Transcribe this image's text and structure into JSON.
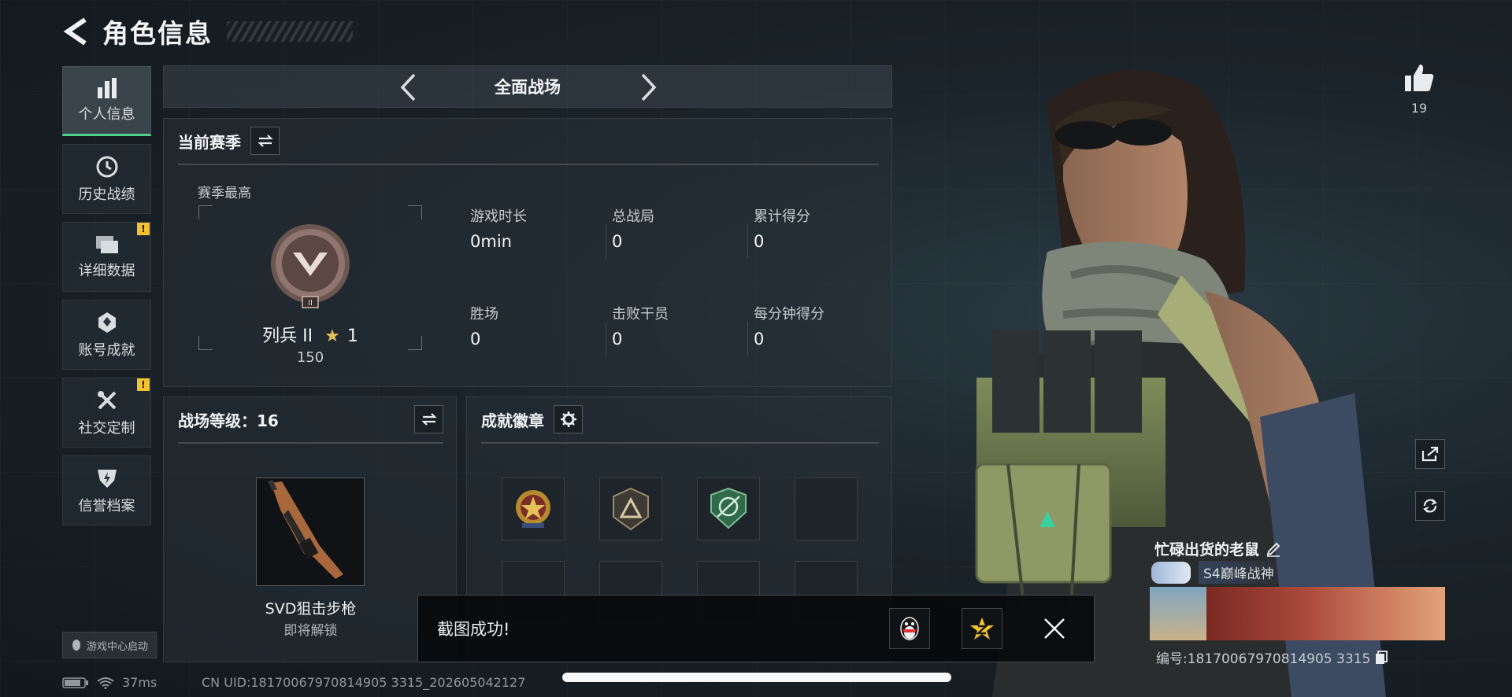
{
  "header": {
    "title": "角色信息"
  },
  "sidebar": {
    "items": [
      {
        "label": "个人信息",
        "icon": "bar-chart-icon",
        "active": true,
        "alert": false
      },
      {
        "label": "历史战绩",
        "icon": "history-icon",
        "active": false,
        "alert": false
      },
      {
        "label": "详细数据",
        "icon": "folder-icon",
        "active": false,
        "alert": true
      },
      {
        "label": "账号成就",
        "icon": "medal-icon",
        "active": false,
        "alert": false
      },
      {
        "label": "社交定制",
        "icon": "tools-icon",
        "active": false,
        "alert": true
      },
      {
        "label": "信誉档案",
        "icon": "shield-icon",
        "active": false,
        "alert": false
      }
    ],
    "alert_mark": "!",
    "launch_badge": "游戏中心启动"
  },
  "mode": {
    "title": "全面战场"
  },
  "season": {
    "title": "当前赛季",
    "subtitle": "赛季最高",
    "rank_name": "列兵 II",
    "rank_stars": "1",
    "rank_points": "150",
    "rank_badge_label": "II",
    "stats": [
      {
        "label": "游戏时长",
        "value": "0min"
      },
      {
        "label": "总战局",
        "value": "0"
      },
      {
        "label": "累计得分",
        "value": "0"
      },
      {
        "label": "胜场",
        "value": "0"
      },
      {
        "label": "击败干员",
        "value": "0"
      },
      {
        "label": "每分钟得分",
        "value": "0"
      }
    ]
  },
  "level": {
    "title": "战场等级：16",
    "weapon_name": "SVD狙击步枪",
    "weapon_status": "即将解锁"
  },
  "badges": {
    "title": "成就徽章"
  },
  "toast": {
    "message": "截图成功!"
  },
  "status": {
    "ping": "37ms",
    "uid": "CN UID:18170067970814905 3315_202605042127"
  },
  "player": {
    "likes": "19",
    "name": "忙碌出货的老鼠",
    "title": "S4巅峰战神",
    "id": "编号:18170067970814905 3315"
  },
  "colors": {
    "active_accent": "#4fd08a",
    "alert": "#f2c230",
    "rank_star": "#e2c35a"
  }
}
